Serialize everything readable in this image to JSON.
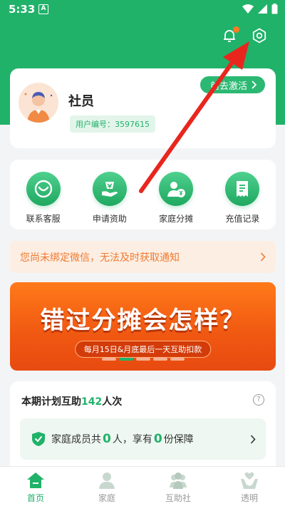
{
  "status_bar": {
    "time": "5:33",
    "notification_letter": "A"
  },
  "colors": {
    "brand_green": "#21b26a",
    "notice_orange": "#f07a30",
    "banner_orange": "#f15a12",
    "annotation_red": "#e8261e"
  },
  "header": {
    "icons": [
      "bell-icon",
      "gear-icon"
    ]
  },
  "profile": {
    "name": "社员",
    "user_id": "用户编号：3597615",
    "activate_label": "前去激活"
  },
  "actions": [
    {
      "label": "联系客服",
      "icon": "smile-icon"
    },
    {
      "label": "申请资助",
      "icon": "money-hand-icon"
    },
    {
      "label": "家庭分摊",
      "icon": "person-coin-icon"
    },
    {
      "label": "充值记录",
      "icon": "receipt-icon"
    }
  ],
  "wechat_notice": {
    "text": "您尚未绑定微信，无法及时获取通知"
  },
  "banner": {
    "title": "错过分摊会怎样？",
    "subtitle": "每月15日&月底最后一天互助扣款",
    "slide_count": 5,
    "active_slide": 2
  },
  "plan": {
    "title_prefix": "本期计划互助",
    "count": "142",
    "title_suffix": "人次",
    "members_prefix": "家庭成员共",
    "members_count": "0",
    "members_mid": "人，享有",
    "guarantee_count": "0",
    "members_suffix": "份保障"
  },
  "tabs": [
    {
      "label": "首页",
      "active": true
    },
    {
      "label": "家庭",
      "active": false
    },
    {
      "label": "互助社",
      "active": false
    },
    {
      "label": "透明",
      "active": false
    }
  ]
}
